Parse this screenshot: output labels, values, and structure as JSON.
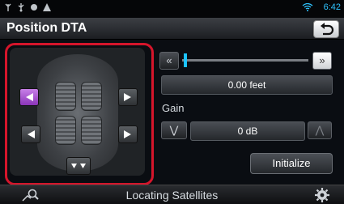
{
  "status": {
    "time": "6:42",
    "icons": [
      "antenna-icon",
      "usb-icon",
      "dot-icon",
      "warning-icon",
      "wifi-icon"
    ]
  },
  "title": "Position DTA",
  "back_icon": "return-icon",
  "seat_panel": {
    "selected_speaker": "front-left",
    "speakers": [
      "front-left",
      "front-right",
      "rear-left",
      "rear-right",
      "subwoofer"
    ]
  },
  "slider": {
    "left_icon": "rewind-icon",
    "right_icon": "fast-forward-icon"
  },
  "distance": "0.00 feet",
  "gain": {
    "label": "Gain",
    "value": "0 dB",
    "down_icon": "chevron-down-icon",
    "up_icon": "chevron-up-icon"
  },
  "initialize_label": "Initialize",
  "bottom": {
    "status_text": "Locating Satellites",
    "left_icon": "search-icon",
    "right_icon": "gear-icon"
  },
  "colors": {
    "accent": "#1cc3ff",
    "highlight": "#d5152b",
    "selected_speaker": "#a855d8"
  }
}
